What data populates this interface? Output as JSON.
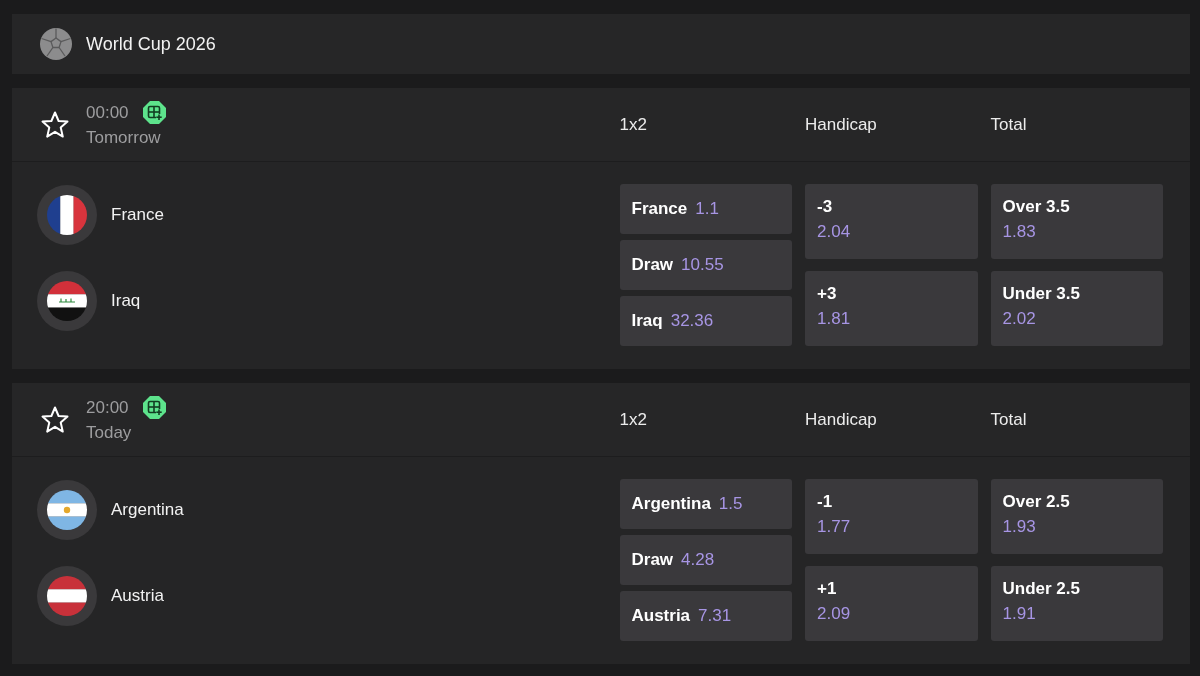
{
  "competition": {
    "title": "World Cup 2026"
  },
  "matches": [
    {
      "favorite": false,
      "time": "00:00",
      "day": "Tomorrow",
      "teams": [
        {
          "name": "France",
          "kind": "tricolor"
        },
        {
          "name": "Iraq",
          "kind": "emblem"
        }
      ],
      "markets": [
        {
          "title": "1x2",
          "kind": "inline",
          "outcomes": [
            {
              "label": "France",
              "odds": "1.1"
            },
            {
              "label": "Draw",
              "odds": "10.55"
            },
            {
              "label": "Iraq",
              "odds": "32.36"
            }
          ]
        },
        {
          "title": "Handicap",
          "kind": "stacked",
          "outcomes": [
            {
              "label": "-3",
              "odds": "2.04"
            },
            {
              "label": "+3",
              "odds": "1.81"
            }
          ]
        },
        {
          "title": "Total",
          "kind": "stacked",
          "outcomes": [
            {
              "label": "Over 3.5",
              "odds": "1.83"
            },
            {
              "label": "Under 3.5",
              "odds": "2.02"
            }
          ]
        }
      ]
    },
    {
      "favorite": false,
      "time": "20:00",
      "day": "Today",
      "teams": [
        {
          "name": "Argentina",
          "kind": "sun"
        },
        {
          "name": "Austria",
          "kind": "bands"
        }
      ],
      "markets": [
        {
          "title": "1x2",
          "kind": "inline",
          "outcomes": [
            {
              "label": "Argentina",
              "odds": "1.5"
            },
            {
              "label": "Draw",
              "odds": "4.28"
            },
            {
              "label": "Austria",
              "odds": "7.31"
            }
          ]
        },
        {
          "title": "Handicap",
          "kind": "stacked",
          "outcomes": [
            {
              "label": "-1",
              "odds": "1.77"
            },
            {
              "label": "+1",
              "odds": "2.09"
            }
          ]
        },
        {
          "title": "Total",
          "kind": "stacked",
          "outcomes": [
            {
              "label": "Over 2.5",
              "odds": "1.93"
            },
            {
              "label": "Under 2.5",
              "odds": "1.91"
            }
          ]
        }
      ]
    }
  ]
}
